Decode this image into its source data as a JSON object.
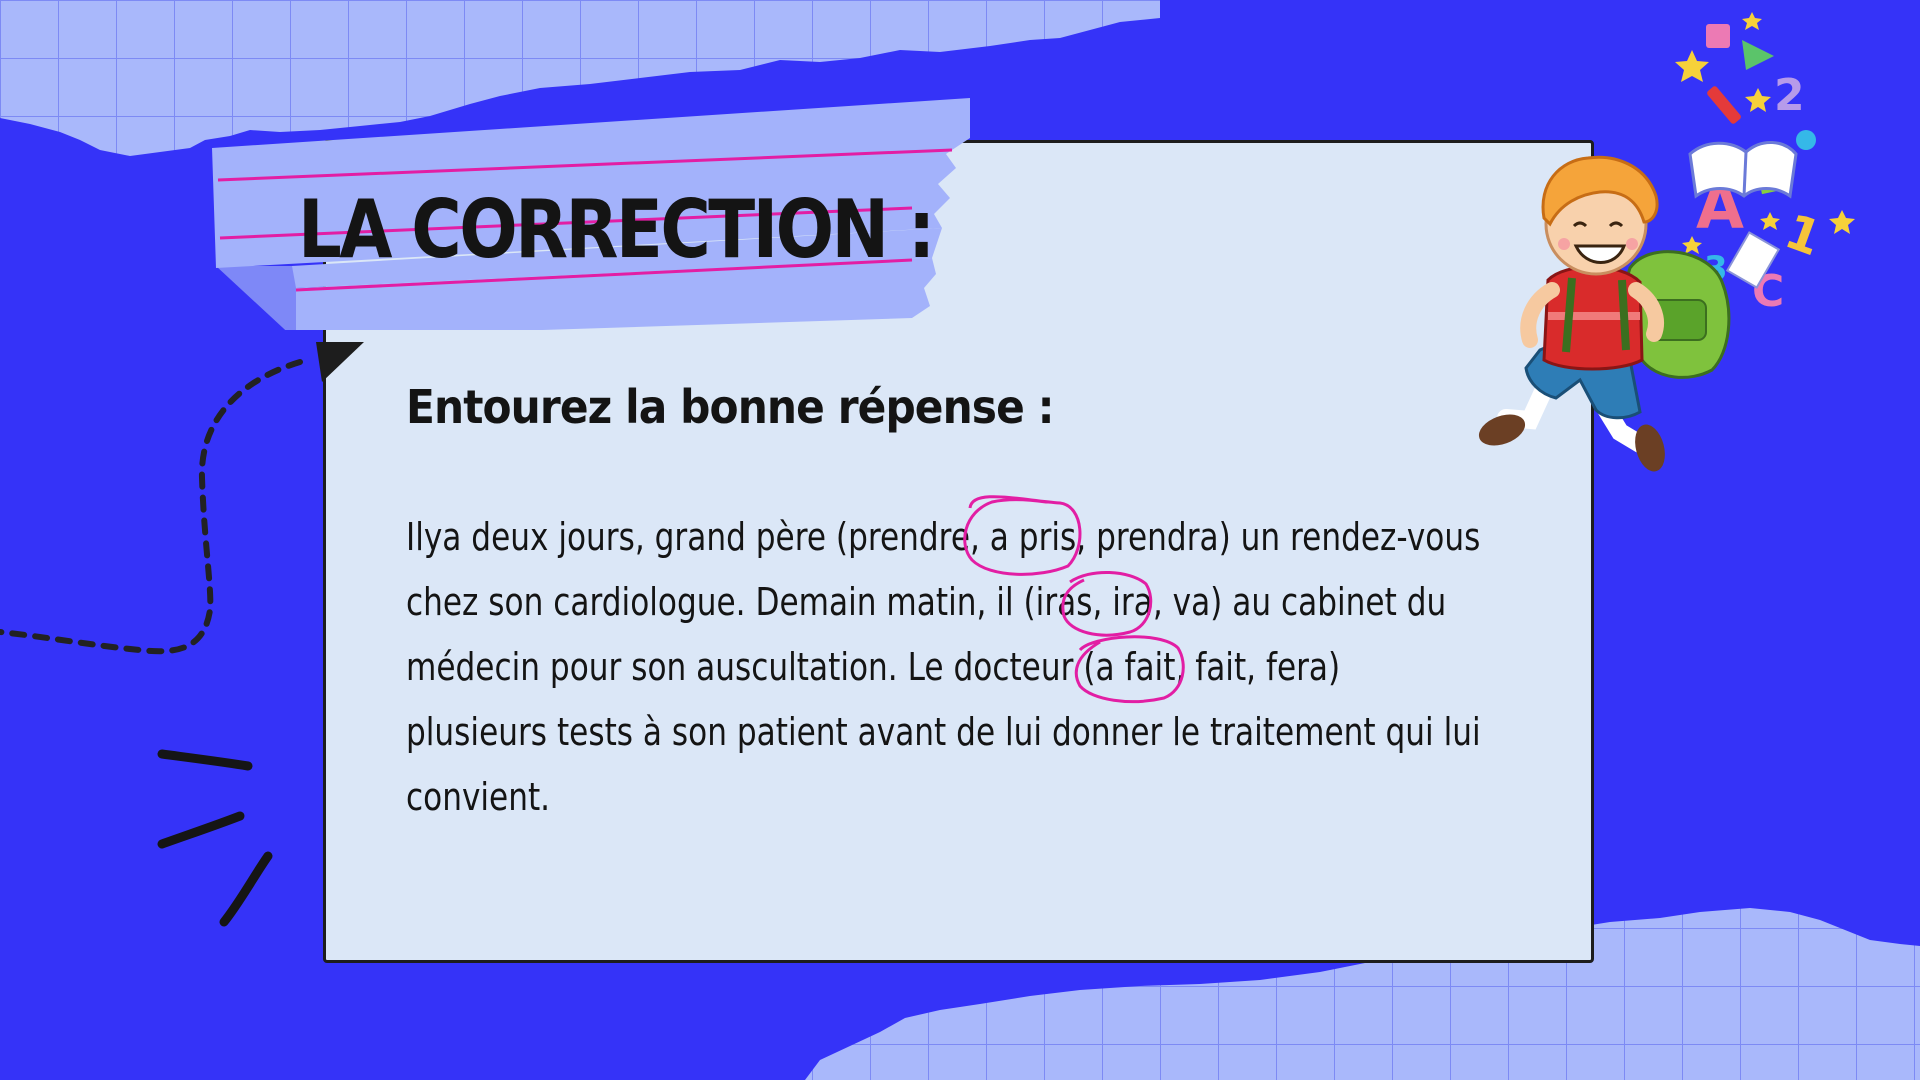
{
  "slide": {
    "title": "LA CORRECTION :",
    "instruction": "Entourez la bonne répense :",
    "paragraph_lines": [
      "Ilya deux  jours, grand père (prendre, a pris, prendra) un rendez-vous",
      "chez son cardiologue. Demain matin, il (iras, ira, va) au cabinet du",
      "médecin pour son auscultation. Le docteur (a fait, fait, fera)",
      "plusieurs tests à son patient avant de lui donner le traitement qui lui",
      "convient."
    ],
    "circled_answers": [
      "a pris",
      "ira",
      "a fait"
    ]
  },
  "illustration": {
    "floating_characters": [
      "2",
      "A",
      "B",
      "1",
      "3",
      "C"
    ],
    "icon": "boy-with-backpack-icon"
  },
  "colors": {
    "background": "#3533f8",
    "grid_paper": "#a9b8fb",
    "card": "#dbe7f7",
    "tape": "#a3b2fb",
    "pink_line": "#e21ea4",
    "text": "#141414"
  }
}
